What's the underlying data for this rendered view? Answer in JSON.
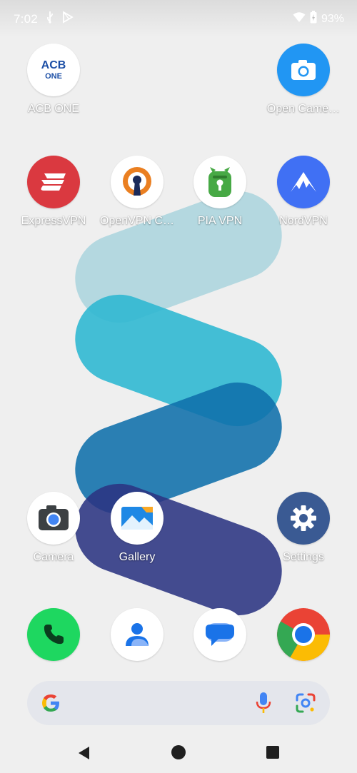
{
  "status_bar": {
    "time": "7:02",
    "battery_percent": "93%",
    "icons": [
      "usb-icon",
      "play-store-icon",
      "wifi-icon",
      "battery-charging-icon"
    ]
  },
  "home": {
    "row1": [
      {
        "label": "ACB ONE",
        "icon": "acb-one-icon",
        "icon_text_top": "ACB",
        "icon_text_bottom": "ONE"
      },
      {
        "label": "Open Came…",
        "icon": "open-camera-icon"
      }
    ],
    "row2": [
      {
        "label": "ExpressVPN",
        "icon": "expressvpn-icon"
      },
      {
        "label": "OpenVPN C…",
        "icon": "openvpn-icon"
      },
      {
        "label": "PIA VPN",
        "icon": "pia-vpn-icon"
      },
      {
        "label": "NordVPN",
        "icon": "nordvpn-icon"
      }
    ],
    "row3": [
      {
        "label": "Camera",
        "icon": "camera-icon"
      },
      {
        "label": "Gallery",
        "icon": "gallery-icon"
      },
      {
        "label": "Settings",
        "icon": "settings-icon"
      }
    ]
  },
  "dock": [
    {
      "name": "phone",
      "icon": "phone-icon"
    },
    {
      "name": "contacts",
      "icon": "contacts-icon"
    },
    {
      "name": "messages",
      "icon": "messages-icon"
    },
    {
      "name": "chrome",
      "icon": "chrome-icon"
    }
  ],
  "search_bar": {
    "icons": [
      "google-g-icon",
      "microphone-icon",
      "google-lens-icon"
    ]
  },
  "nav_bar": {
    "buttons": [
      "back-button",
      "home-button",
      "recents-button"
    ]
  },
  "colors": {
    "background": "#efefef",
    "wallpaper_light_blue": "#a9d3dd",
    "wallpaper_cyan": "#3bbcd4",
    "wallpaper_blue": "#1a7bb1",
    "wallpaper_indigo": "#373f86"
  }
}
